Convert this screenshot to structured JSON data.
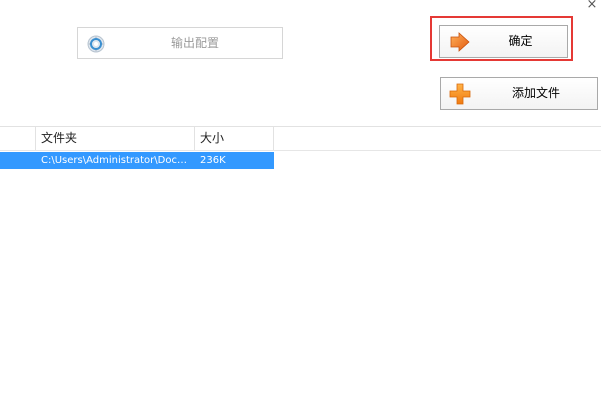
{
  "window": {
    "close_glyph": "×"
  },
  "toolbar": {
    "output_config_label": "输出配置",
    "output_config_icon": "gear-icon",
    "confirm_label": "确定",
    "confirm_icon": "arrow-right-icon",
    "add_file_label": "添加文件",
    "add_file_icon": "plus-icon",
    "highlight_color": "#e53935"
  },
  "file_list": {
    "columns": [
      "",
      "文件夹",
      "大小"
    ],
    "rows": [
      {
        "folder": "C:\\Users\\Administrator\\Doc…",
        "size": "236K",
        "selected": true
      }
    ],
    "selection_color": "#3399ff"
  }
}
